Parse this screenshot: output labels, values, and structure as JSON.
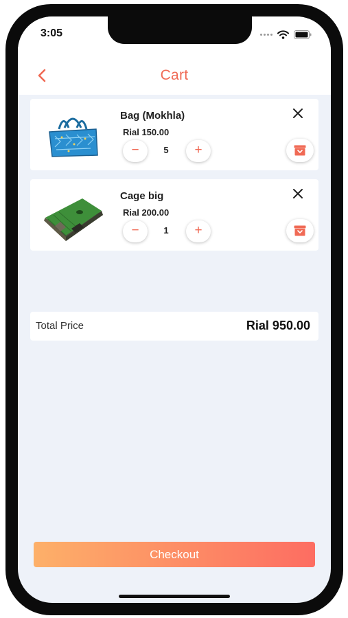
{
  "status": {
    "time": "3:05"
  },
  "header": {
    "title": "Cart"
  },
  "cart": {
    "items": [
      {
        "name": "Bag (Mokhla)",
        "price": "Rial 150.00",
        "quantity": "5",
        "minus": "−",
        "plus": "+"
      },
      {
        "name": "Cage big",
        "price": "Rial 200.00",
        "quantity": "1",
        "minus": "−",
        "plus": "+"
      }
    ]
  },
  "total": {
    "label": "Total Price",
    "value": "Rial 950.00"
  },
  "checkout": {
    "label": "Checkout"
  },
  "icons": {
    "back": "chevron-left-icon",
    "remove": "close-icon",
    "archive": "archive-box-icon"
  },
  "colors": {
    "accent": "#f06a55",
    "checkout_start": "#fdb069",
    "checkout_end": "#fd6d62",
    "background": "#eef2f9"
  }
}
